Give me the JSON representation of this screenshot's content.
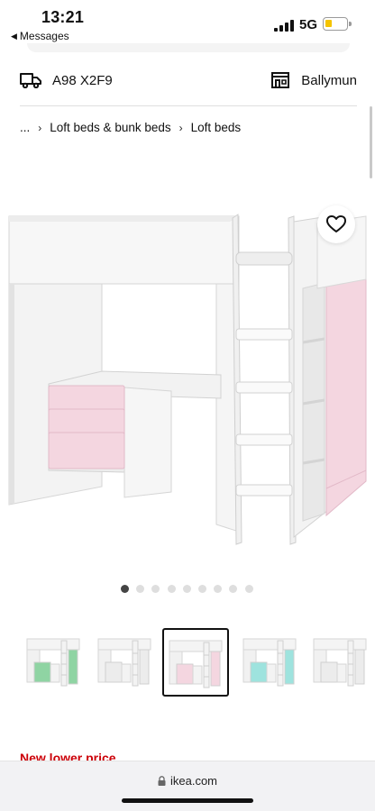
{
  "status_bar": {
    "time": "13:21",
    "back_app": "Messages",
    "network": "5G",
    "battery_level": 0.3,
    "battery_color": "#f5c400"
  },
  "location": {
    "postcode": "A98 X2F9",
    "postcode_icon": "delivery-truck-icon",
    "store": "Ballymun",
    "store_icon": "store-icon"
  },
  "breadcrumb": {
    "ellipsis": "...",
    "items": [
      "Loft beds & bunk beds",
      "Loft beds"
    ]
  },
  "product": {
    "image_icon": "loft-bed-with-desk-and-wardrobe",
    "accent_color": "#f4d6e0",
    "favourite_icon": "heart-icon"
  },
  "carousel": {
    "total_slides": 9,
    "active_index": 0
  },
  "thumbnails": {
    "selected_index": 2,
    "colors": [
      "#8fd4a3",
      "#ececec",
      "#f4d6e0",
      "#9ee3de",
      "#ececec"
    ]
  },
  "promo": {
    "label": "New lower price",
    "color": "#cc0008"
  },
  "url_bar": {
    "url": "ikea.com",
    "lock_icon": "lock-icon"
  }
}
